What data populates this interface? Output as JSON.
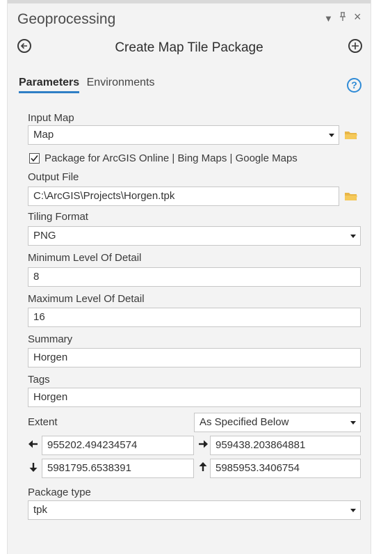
{
  "window": {
    "title": "Geoprocessing",
    "dropdown_glyph": "▾",
    "pin_glyph": "ᵖ",
    "close_glyph": "×"
  },
  "tool": {
    "title": "Create Map Tile Package"
  },
  "tabs": [
    {
      "label": "Parameters",
      "active": true
    },
    {
      "label": "Environments",
      "active": false
    }
  ],
  "help_glyph": "?",
  "params": {
    "input_map": {
      "label": "Input Map",
      "value": "Map"
    },
    "package_online": {
      "label": "Package for ArcGIS Online | Bing Maps | Google Maps",
      "checked": true
    },
    "output_file": {
      "label": "Output File",
      "value": "C:\\ArcGIS\\Projects\\Horgen.tpk"
    },
    "tiling_format": {
      "label": "Tiling Format",
      "value": "PNG"
    },
    "min_lod": {
      "label": "Minimum Level Of Detail",
      "value": "8"
    },
    "max_lod": {
      "label": "Maximum Level Of Detail",
      "value": "16"
    },
    "summary": {
      "label": "Summary",
      "value": "Horgen"
    },
    "tags": {
      "label": "Tags",
      "value": "Horgen"
    },
    "extent": {
      "label": "Extent",
      "mode": "As Specified Below",
      "left": "955202.494234574",
      "right": "959438.203864881",
      "bottom": "5981795.6538391",
      "top": "5985953.3406754"
    },
    "package_type": {
      "label": "Package type",
      "value": "tpk"
    }
  },
  "colors": {
    "accent": "#2f7fc5",
    "folder": "#e8b648",
    "panel_bg": "#f3f3f3"
  }
}
